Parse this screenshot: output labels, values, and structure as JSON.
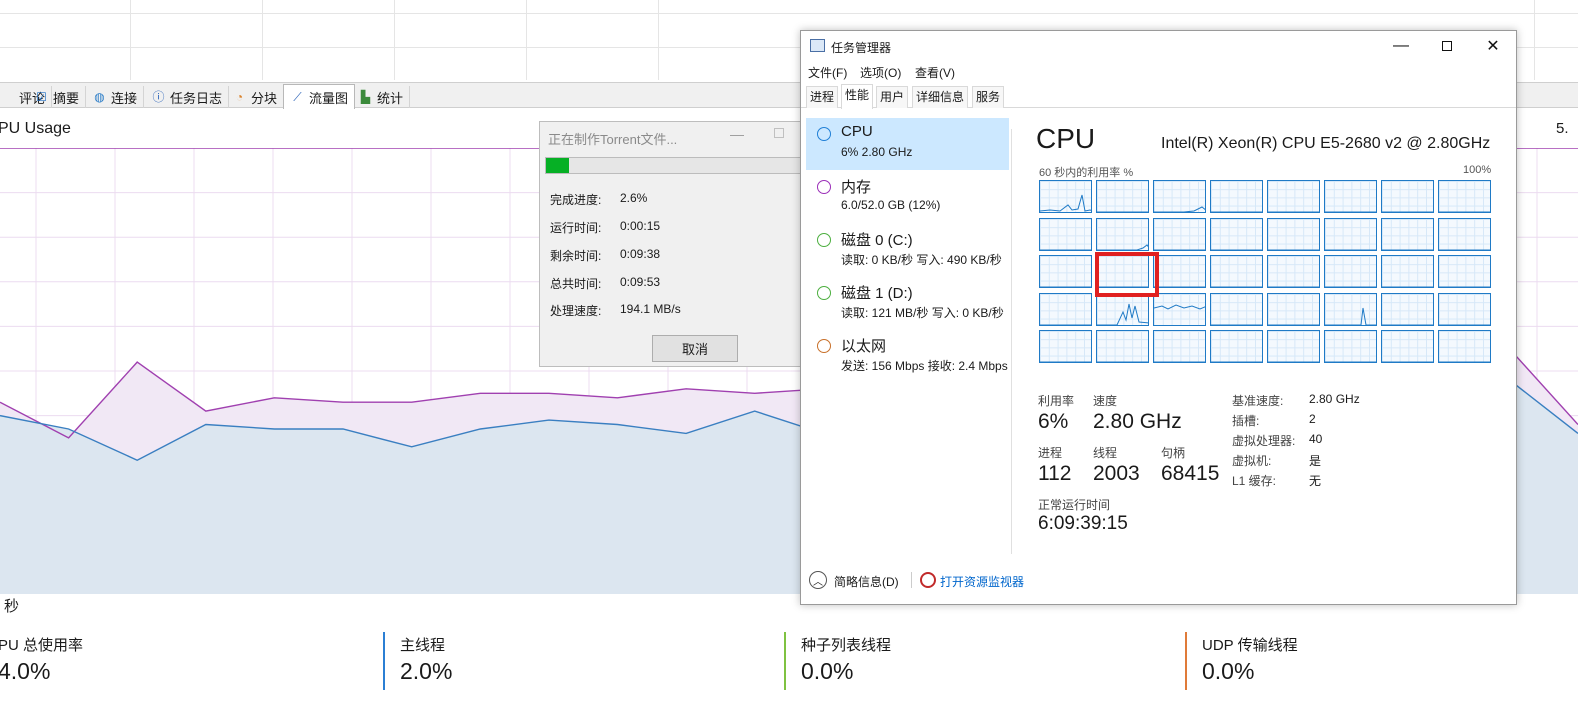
{
  "client": {
    "tabs": [
      {
        "label": "评论",
        "icon": "comment-icon"
      },
      {
        "label": "摘要",
        "icon": "checklist-icon"
      },
      {
        "label": "连接",
        "icon": "globe-icon"
      },
      {
        "label": "任务日志",
        "icon": "info-icon"
      },
      {
        "label": "分块",
        "icon": "pie-icon"
      },
      {
        "label": "流量图",
        "icon": "line-chart-icon"
      },
      {
        "label": "统计",
        "icon": "stats-icon"
      }
    ],
    "active_tab": "流量图",
    "graph_title": "PU Usage",
    "graph_scale": "5.",
    "graph_unit": "秒",
    "stats": [
      {
        "label": "PU 总使用率",
        "value": "4.0%",
        "color": "#ffffff"
      },
      {
        "label": "主线程",
        "value": "2.0%",
        "color": "#2b7fd4"
      },
      {
        "label": "种子列表线程",
        "value": "0.0%",
        "color": "#7fc241"
      },
      {
        "label": "UDP 传输线程",
        "value": "0.0%",
        "color": "#e07b39"
      }
    ]
  },
  "chart_data": {
    "type": "area",
    "series": [
      {
        "color": "#a040b0",
        "values": [
          43,
          35,
          52,
          41,
          44,
          43,
          43,
          45,
          45,
          44,
          46,
          45,
          46,
          45,
          44,
          42,
          53,
          40,
          38,
          40,
          35,
          41,
          55,
          38
        ]
      },
      {
        "color": "#3a7fc1",
        "values": [
          40,
          37,
          30,
          38,
          37,
          37,
          33,
          37,
          39,
          38,
          36,
          41,
          36,
          37,
          39,
          40,
          53,
          38,
          39,
          35,
          37,
          33,
          48,
          36
        ]
      }
    ]
  },
  "torrent_dialog": {
    "title": "正在制作Torrent文件...",
    "progress": 0.026,
    "rows": [
      {
        "label": "完成进度:",
        "value": "2.6%"
      },
      {
        "label": "运行时间:",
        "value": "0:00:15"
      },
      {
        "label": "剩余时间:",
        "value": "0:09:38"
      },
      {
        "label": "总共时间:",
        "value": "0:09:53"
      },
      {
        "label": "处理速度:",
        "value": "194.1 MB/s"
      }
    ],
    "cancel_label": "取消"
  },
  "task_manager": {
    "title": "任务管理器",
    "menu": [
      "文件(F)",
      "选项(O)",
      "查看(V)"
    ],
    "tabs": [
      "进程",
      "性能",
      "用户",
      "详细信息",
      "服务"
    ],
    "active_tab": "性能",
    "resources": [
      {
        "name": "CPU",
        "sub": "6% 2.80 GHz",
        "color": "#1f7fd6"
      },
      {
        "name": "内存",
        "sub": "6.0/52.0 GB (12%)",
        "color": "#9b2fb8"
      },
      {
        "name": "磁盘 0 (C:)",
        "sub": "读取: 0 KB/秒 写入: 490 KB/秒",
        "color": "#4caf3f"
      },
      {
        "name": "磁盘 1 (D:)",
        "sub": "读取: 121 MB/秒 写入: 0 KB/秒",
        "color": "#4caf3f"
      },
      {
        "name": "以太网",
        "sub": "发送: 156 Mbps 接收: 2.4 Mbps",
        "color": "#c8702a"
      }
    ],
    "cpu": {
      "heading": "CPU",
      "model": "Intel(R) Xeon(R) CPU E5-2680 v2 @ 2.80GHz",
      "graph_label": "60 秒内的利用率 %",
      "graph_max": "100%",
      "utilization_label": "利用率",
      "utilization": "6%",
      "speed_label": "速度",
      "speed": "2.80 GHz",
      "processes_label": "进程",
      "processes": "112",
      "threads_label": "线程",
      "threads": "2003",
      "handles_label": "句柄",
      "handles": "68415",
      "uptime_label": "正常运行时间",
      "uptime": "6:09:39:15",
      "details": [
        {
          "k": "基准速度:",
          "v": "2.80 GHz"
        },
        {
          "k": "插槽:",
          "v": "2"
        },
        {
          "k": "虚拟处理器:",
          "v": "40"
        },
        {
          "k": "虚拟机:",
          "v": "是"
        },
        {
          "k": "L1 缓存:",
          "v": "无"
        }
      ]
    },
    "footer_less": "简略信息(D)",
    "footer_link": "打开资源监视器"
  }
}
